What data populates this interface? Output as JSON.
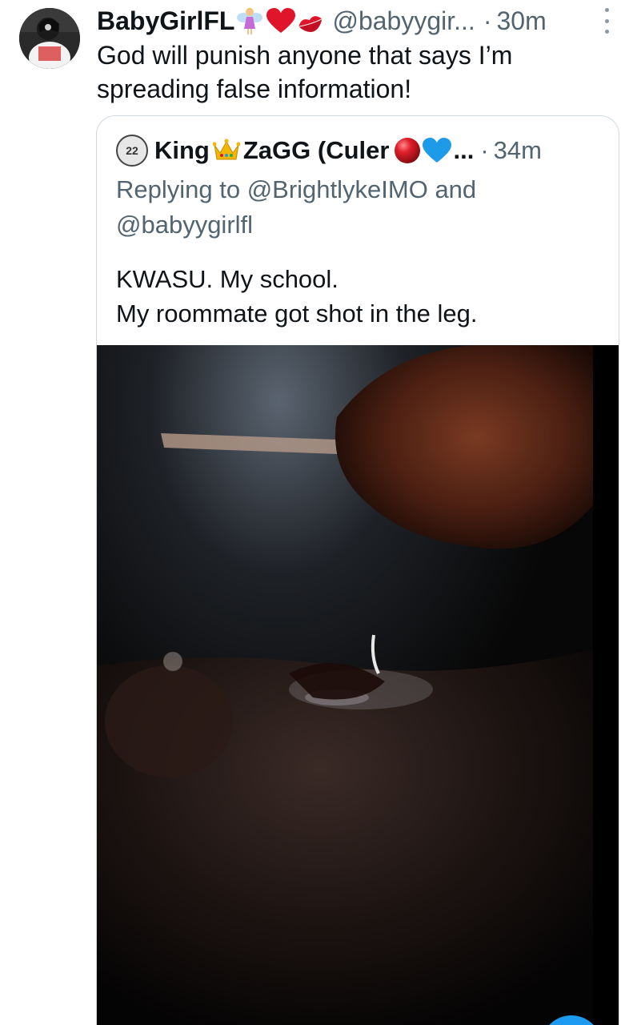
{
  "tweet": {
    "display_name": "BabyGirlFL",
    "handle": "@babyygir...",
    "separator": "·",
    "time": "30m",
    "text": "God will punish anyone that says I’m spreading false information!",
    "name_emojis": [
      "fairy-emoji",
      "red-heart-emoji",
      "kiss-mark-emoji"
    ]
  },
  "quote": {
    "avatar_label": "22",
    "name_part1": "King",
    "name_part2": "ZaGG (Culer",
    "name_emojis": [
      "crown-emoji",
      "red-ball-emoji",
      "blue-heart-emoji"
    ],
    "ellipsis": "...",
    "separator": "·",
    "time": "34m",
    "replying_line1": "Replying to @BrightlykeIMO and",
    "replying_line2": "@babyygirlfl",
    "text_line1": "KWASU. My school.",
    "text_line2": "My roommate got shot in the leg.",
    "media": "dark-photo"
  },
  "colors": {
    "text_primary": "#0f1419",
    "text_secondary": "#536471",
    "border": "#cfd9de",
    "accent": "#1d9bf0",
    "heart_red": "#e0142a",
    "heart_blue": "#1e9be8"
  }
}
